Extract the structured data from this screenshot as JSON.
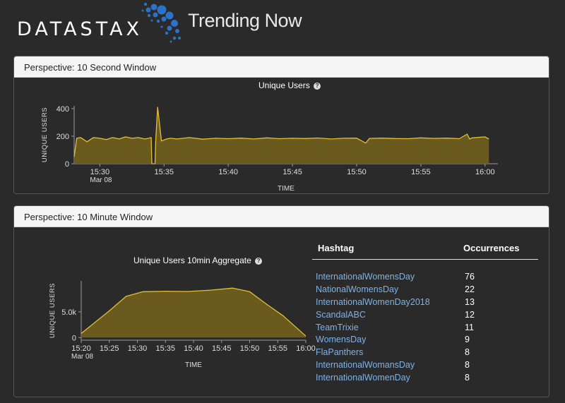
{
  "header": {
    "logo_text": "DATASTAX",
    "title": "Trending Now"
  },
  "panel1": {
    "heading": "Perspective: 10 Second Window",
    "chart_title": "Unique Users"
  },
  "panel2": {
    "heading": "Perspective: 10 Minute Window",
    "chart_title": "Unique Users 10min Aggregate"
  },
  "help_glyph": "?",
  "table": {
    "col_hashtag": "Hashtag",
    "col_occurrences": "Occurrences",
    "rows": [
      {
        "tag": "InternationalWomensDay",
        "count": "76"
      },
      {
        "tag": "NationalWomensDay",
        "count": "22"
      },
      {
        "tag": "InternationalWomenDay2018",
        "count": "13"
      },
      {
        "tag": "ScandalABC",
        "count": "12"
      },
      {
        "tag": "TeamTrixie",
        "count": "11"
      },
      {
        "tag": "WomensDay",
        "count": "9"
      },
      {
        "tag": "FlaPanthers",
        "count": "8"
      },
      {
        "tag": "InternationalWomansDay",
        "count": "8"
      },
      {
        "tag": "InternationalWomenDay",
        "count": "8"
      }
    ]
  },
  "colors": {
    "line": "#e2c035",
    "fill": "#6b5a1d",
    "link": "#7fb2e5"
  },
  "chart_data": [
    {
      "type": "area",
      "title": "Unique Users",
      "xlabel": "TIME",
      "ylabel": "UNIQUE USERS",
      "xlim": [
        "15:28",
        "16:01"
      ],
      "ylim": [
        0,
        420
      ],
      "x_ticks": [
        "15:30",
        "15:35",
        "15:40",
        "15:45",
        "15:50",
        "15:55",
        "16:00"
      ],
      "x_date_label": "Mar 08",
      "y_ticks": [
        "0",
        "200",
        "400"
      ],
      "y_tick_values": [
        0,
        200,
        400
      ],
      "x_minutes": [
        28.0,
        28.2,
        28.5,
        29.0,
        29.5,
        30.0,
        30.5,
        31.0,
        31.5,
        32.0,
        32.5,
        33.0,
        33.5,
        33.8,
        34.0,
        34.05,
        34.3,
        34.35,
        34.5,
        34.8,
        35.2,
        35.5,
        36.0,
        37.0,
        38.0,
        39.0,
        40.0,
        41.0,
        42.0,
        43.0,
        44.0,
        45.0,
        46.0,
        47.0,
        48.0,
        49.0,
        50.0,
        50.7,
        51.0,
        52.0,
        53.0,
        54.0,
        55.0,
        56.0,
        57.0,
        58.0,
        58.6,
        58.8,
        59.0,
        60.0,
        60.3
      ],
      "values": [
        50,
        185,
        190,
        160,
        190,
        185,
        175,
        190,
        180,
        195,
        185,
        190,
        180,
        185,
        190,
        0,
        0,
        170,
        410,
        165,
        180,
        185,
        180,
        190,
        178,
        185,
        182,
        186,
        180,
        188,
        182,
        185,
        183,
        187,
        180,
        185,
        186,
        150,
        184,
        186,
        183,
        182,
        188,
        184,
        186,
        182,
        215,
        180,
        188,
        195,
        180
      ]
    },
    {
      "type": "area",
      "title": "Unique Users 10min Aggregate",
      "xlabel": "TIME",
      "ylabel": "UNIQUE USERS",
      "xlim": [
        "15:20",
        "16:00"
      ],
      "ylim": [
        -500,
        11000
      ],
      "x_ticks": [
        "15:20",
        "15:25",
        "15:30",
        "15:35",
        "15:40",
        "15:45",
        "15:50",
        "15:55",
        "16:00"
      ],
      "x_date_label": "Mar 08",
      "y_ticks": [
        "0",
        "5.0k"
      ],
      "y_tick_values": [
        0,
        5000
      ],
      "x_minutes": [
        20,
        25,
        28,
        31,
        35,
        39,
        43,
        47,
        50,
        53,
        56,
        60
      ],
      "values": [
        800,
        5200,
        8000,
        8900,
        9000,
        8950,
        9200,
        9600,
        8900,
        6500,
        4200,
        300
      ]
    }
  ]
}
